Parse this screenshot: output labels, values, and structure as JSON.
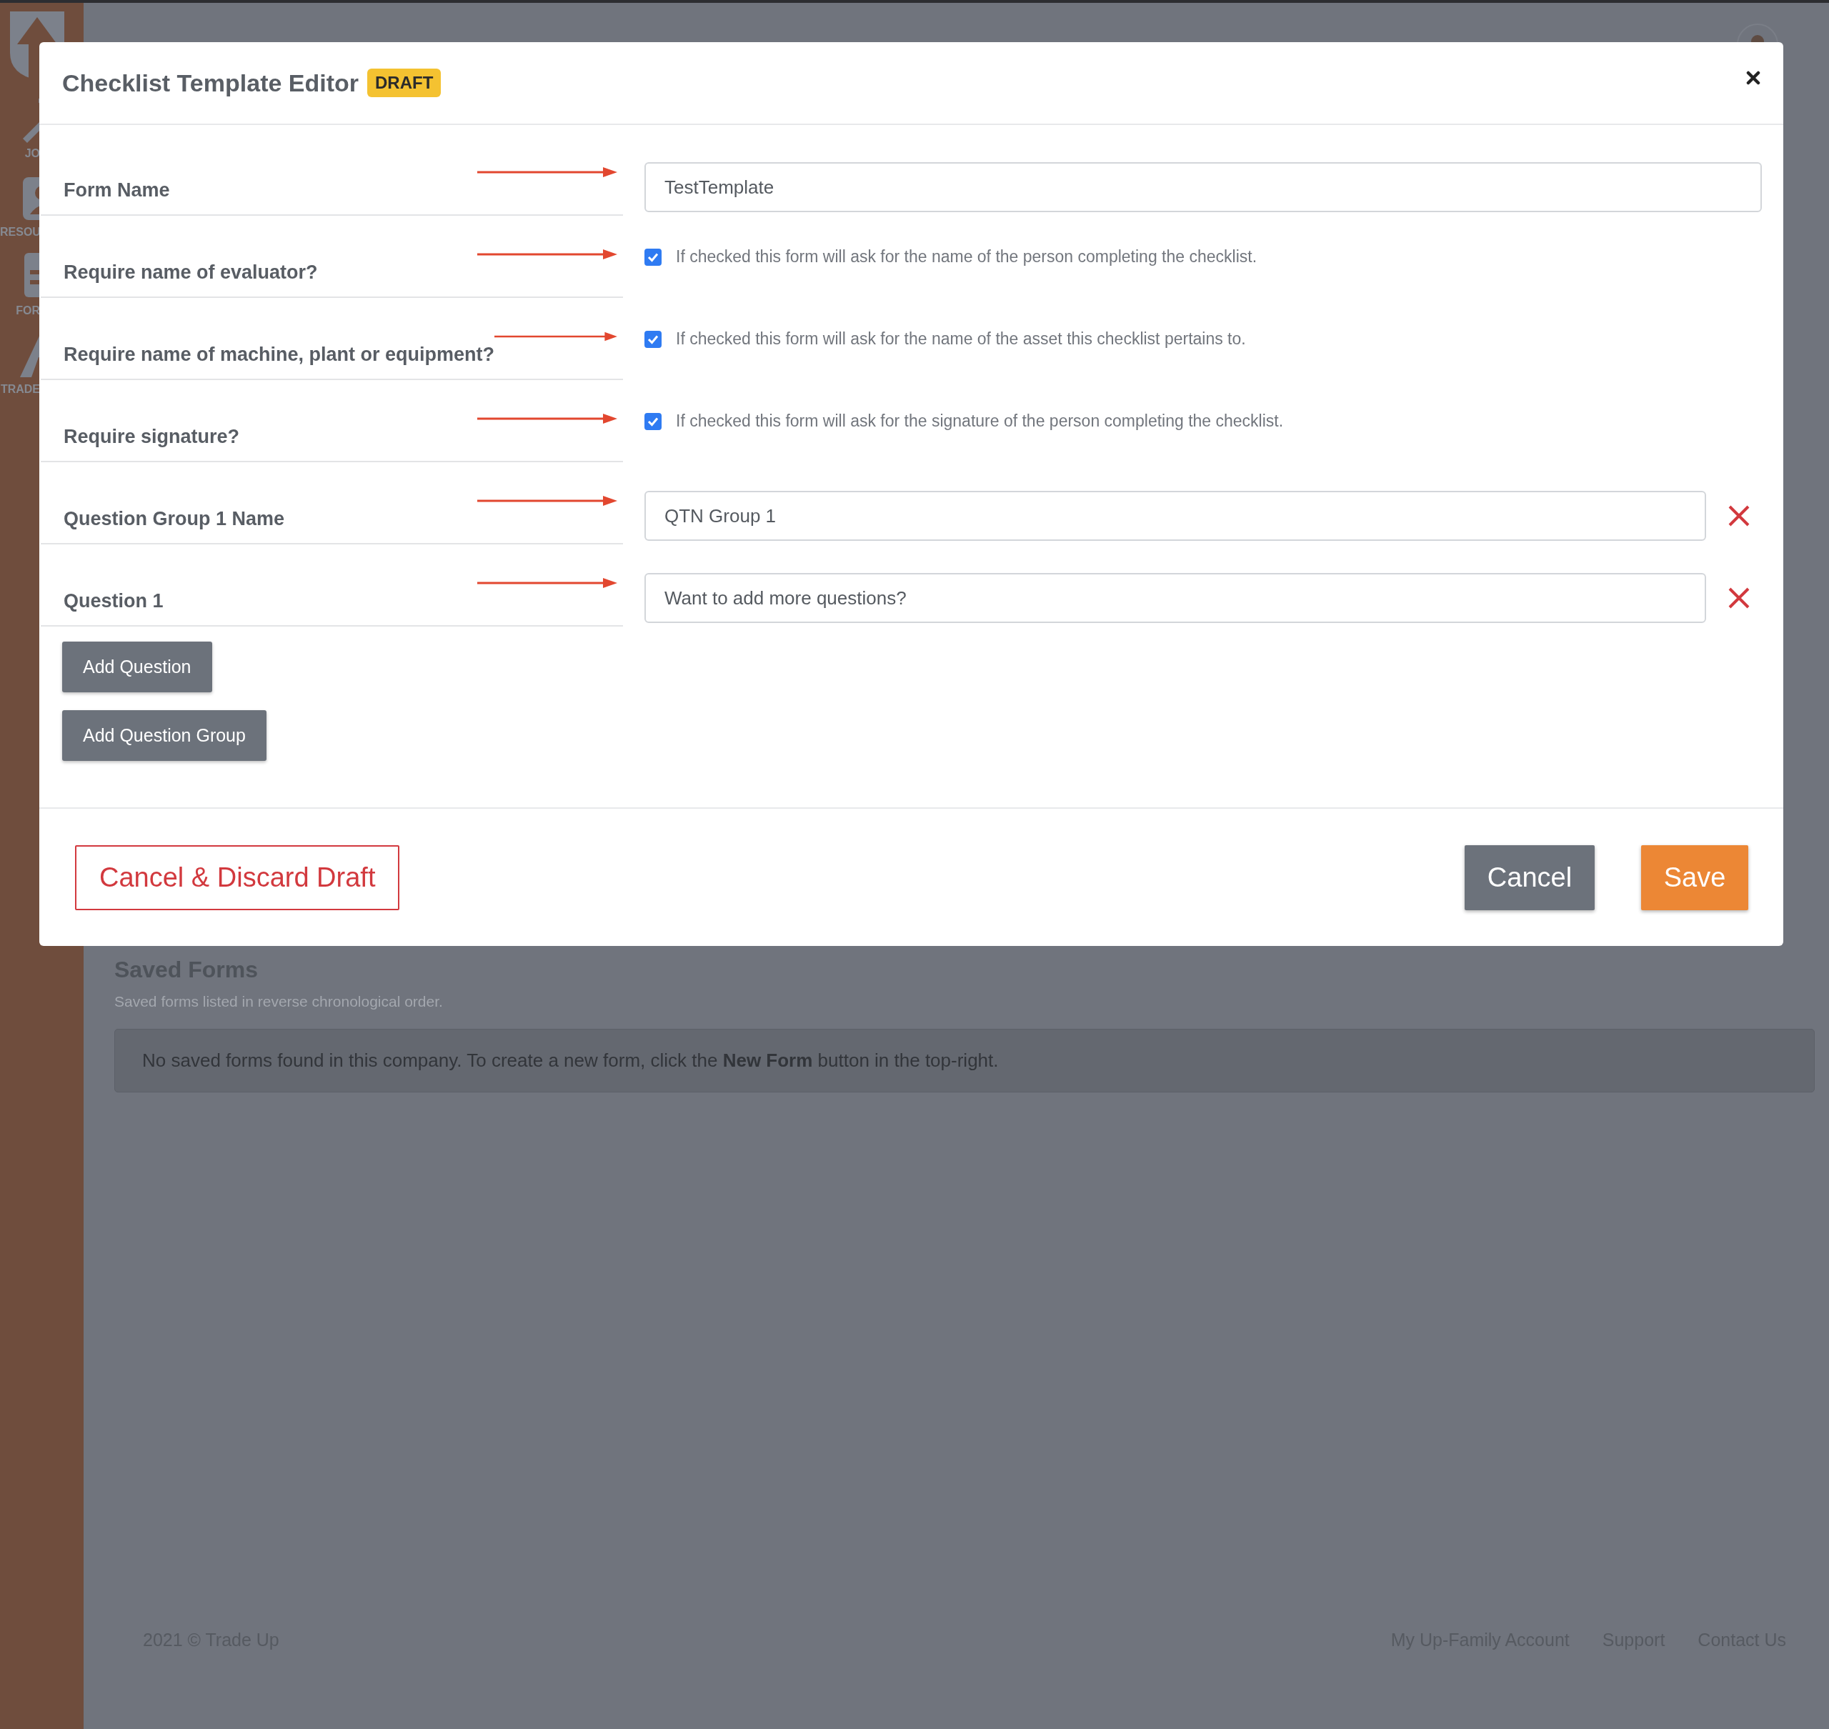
{
  "sidebar": {
    "items": [
      {
        "kind": "jobs",
        "label": "JO"
      },
      {
        "kind": "resources",
        "label": "RESOU"
      },
      {
        "kind": "forms",
        "label": "FOR"
      },
      {
        "kind": "trades",
        "label": "TRADE"
      }
    ]
  },
  "saved_forms": {
    "title": "Saved Forms",
    "subtitle": "Saved forms listed in reverse chronological order.",
    "notice": "No saved forms found in this company. To create a new form, click the **New Form** button in the top-right."
  },
  "footer": {
    "copyright": "2021 © Trade Up",
    "links": [
      "My Up-Family Account",
      "Support",
      "Contact Us"
    ]
  },
  "dialog": {
    "title": "Checklist Template Editor",
    "badge": "DRAFT",
    "rows": [
      {
        "kind": "text",
        "label": "Form Name",
        "value": "TestTemplate",
        "removable": false
      },
      {
        "kind": "checkbox",
        "label": "Require name of evaluator?",
        "checked": true,
        "hint": "If checked this form will ask for the name of the person completing the checklist."
      },
      {
        "kind": "checkbox",
        "label": "Require name of machine, plant or equipment?",
        "checked": true,
        "hint": "If checked this form will ask for the name of the asset this checklist pertains to."
      },
      {
        "kind": "checkbox",
        "label": "Require signature?",
        "checked": true,
        "hint": "If checked this form will ask for the signature of the person completing the checklist."
      },
      {
        "kind": "text",
        "label": "Question Group 1 Name",
        "value": "QTN Group 1",
        "removable": true
      },
      {
        "kind": "text",
        "label": "Question 1",
        "value": "Want to add more questions?",
        "removable": true
      }
    ],
    "add_buttons": [
      "Add Question",
      "Add Question Group"
    ],
    "discard_button": "Cancel & Discard Draft",
    "cancel_button": "Cancel",
    "save_button": "Save"
  }
}
